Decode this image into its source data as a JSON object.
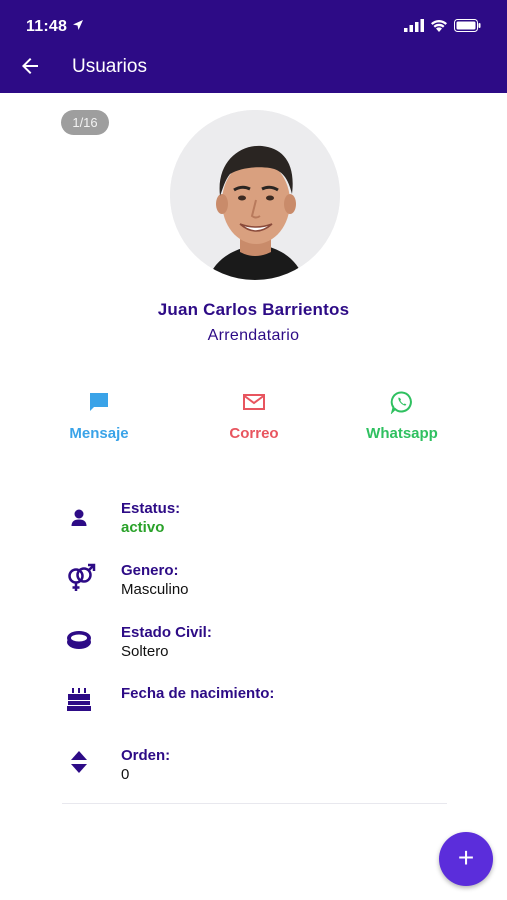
{
  "status_bar": {
    "time": "11:48"
  },
  "app_bar": {
    "title": "Usuarios"
  },
  "profile": {
    "counter": "1/16",
    "name": "Juan Carlos Barrientos",
    "role": "Arrendatario"
  },
  "actions": [
    {
      "label": "Mensaje",
      "icon": "chat-icon",
      "color": "#3aa3e8"
    },
    {
      "label": "Correo",
      "icon": "mail-icon",
      "color": "#e8555f"
    },
    {
      "label": "Whatsapp",
      "icon": "whatsapp-icon",
      "color": "#2fc060"
    }
  ],
  "details": [
    {
      "label": "Estatus:",
      "value": "activo",
      "icon": "person-icon"
    },
    {
      "label": "Genero:",
      "value": "Masculino",
      "icon": "gender-icon"
    },
    {
      "label": "Estado Civil:",
      "value": "Soltero",
      "icon": "ring-icon"
    },
    {
      "label": "Fecha de nacimiento:",
      "value": "",
      "icon": "cake-icon"
    },
    {
      "label": "Orden:",
      "value": "0",
      "icon": "sort-icon"
    }
  ],
  "fab": {
    "label": "+"
  },
  "colors": {
    "primary": "#2d0b86",
    "fab": "#5b2ddb",
    "active": "#2aa22a"
  }
}
